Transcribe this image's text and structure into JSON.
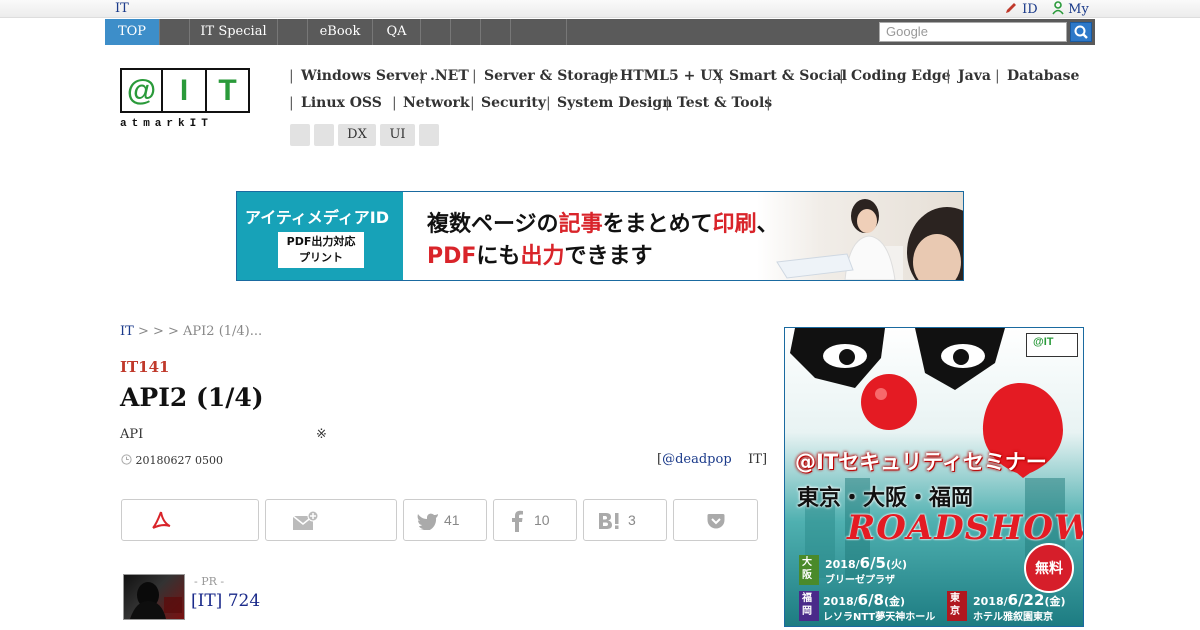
{
  "topbar": {
    "site": "IT",
    "id_link": "ID",
    "my_link": "My"
  },
  "nav": {
    "items": [
      "TOP",
      "",
      "IT Special",
      "",
      "eBook",
      "QA",
      "",
      "",
      "",
      ""
    ],
    "search_placeholder": "Google"
  },
  "logo": {
    "letters": [
      "@",
      "I",
      "T"
    ],
    "subtitle": "atmarkIT"
  },
  "categories": {
    "row1": [
      "Windows Server",
      ".NET",
      "Server & Storage",
      "HTML5 + UX",
      "Smart & Social",
      "Coding Edge",
      "Java",
      "Database"
    ],
    "row2": [
      "Linux  OSS",
      "Network",
      "Security",
      "System Design",
      "Test & Tools"
    ],
    "tags": [
      "",
      "",
      "DX",
      "UI",
      ""
    ]
  },
  "banner": {
    "brand": "アイティメディアID",
    "badge_line1": "PDF出力対応",
    "badge_line2": "プリント",
    "headline1_a": "複数ページの",
    "headline1_b": "記事",
    "headline1_c": "をまとめて",
    "headline1_d": "印刷",
    "headline1_e": "、",
    "headline2_a": "PDF",
    "headline2_b": "にも",
    "headline2_c": "出力",
    "headline2_d": "できます"
  },
  "article": {
    "breadcrumb_home": "IT",
    "breadcrumb_rest": " >  >  > API2 (1/4)...",
    "kicker": "IT141",
    "title": "API2 (1/4)",
    "lead": "API",
    "lead_mark": "※",
    "date": "20180627 0500",
    "author_bracket_open": "[",
    "author_handle": "@deadpop",
    "author_suffix": "IT]"
  },
  "share": {
    "twitter_count": "41",
    "facebook_count": "10",
    "hatena_count": "3"
  },
  "pr": {
    "label": "- PR -",
    "text": "[IT] 724"
  },
  "ad": {
    "logo": "@IT",
    "title": "@ITセキュリティセミナー",
    "cities": "東京・大阪・福岡",
    "roadshow": "ROADSHOW",
    "free": "無料",
    "osaka_tag": "大阪",
    "osaka_year": "2018/",
    "osaka_date": "6/5",
    "osaka_dow": "(火)",
    "osaka_venue": "ブリーゼプラザ",
    "fukuoka_tag": "福岡",
    "fukuoka_year": "2018/",
    "fukuoka_date": "6/8",
    "fukuoka_dow": "(金)",
    "fukuoka_venue": "レソラNTT夢天神ホール",
    "tokyo_tag": "東京",
    "tokyo_year": "2018/",
    "tokyo_date": "6/22",
    "tokyo_dow": "(金)",
    "tokyo_venue": "ホテル雅叙園東京"
  },
  "colors": {
    "nav_active": "#3d8ec9",
    "kicker": "#c0392b",
    "link": "#1a3a8a",
    "logo_green": "#2a9a3a"
  }
}
